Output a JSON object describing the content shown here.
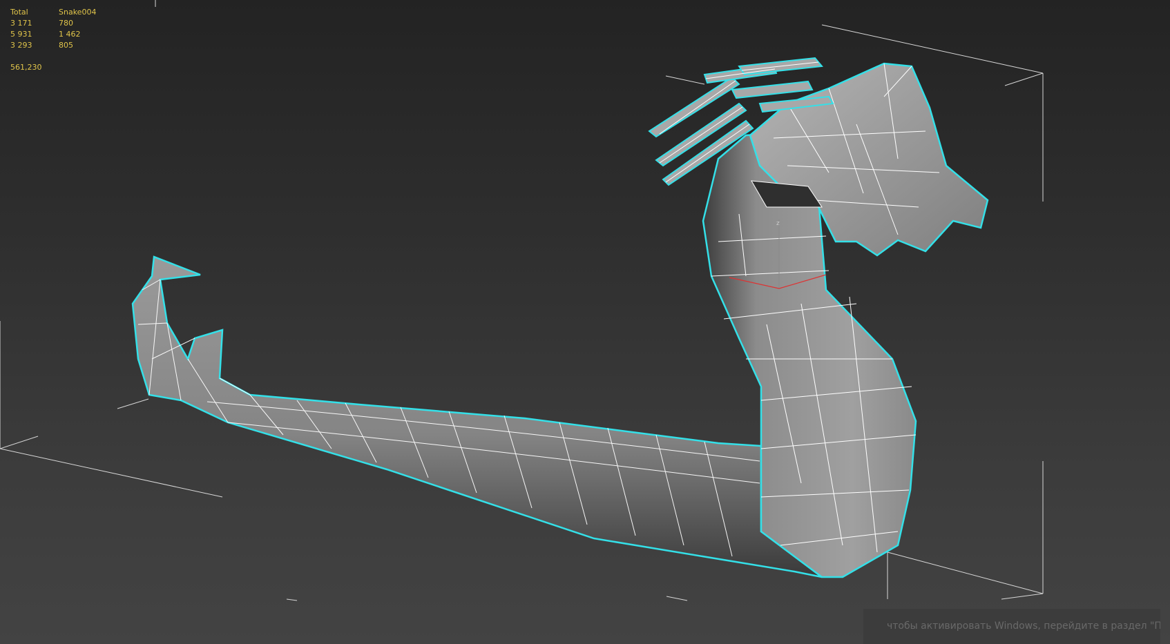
{
  "viewport": {
    "stats": {
      "header": {
        "label": "Total",
        "object": "Snake004"
      },
      "rows": [
        {
          "total": "3 171",
          "object": "780"
        },
        {
          "total": "5 931",
          "object": "1 462"
        },
        {
          "total": "3 293",
          "object": "805"
        }
      ],
      "fps": "561,230"
    },
    "gizmo_axis_label": "z",
    "selected_object": "Snake004",
    "colors": {
      "background_top": "#232323",
      "background_bottom": "#434343",
      "selection_outline": "#34e0e8",
      "stats_text": "#e0c44a",
      "mesh_fill": "#8a8a8a",
      "wireframe": "#ffffff"
    },
    "activation_notice": "чтобы активировать Windows, перейдите в раздел \"Пара"
  }
}
